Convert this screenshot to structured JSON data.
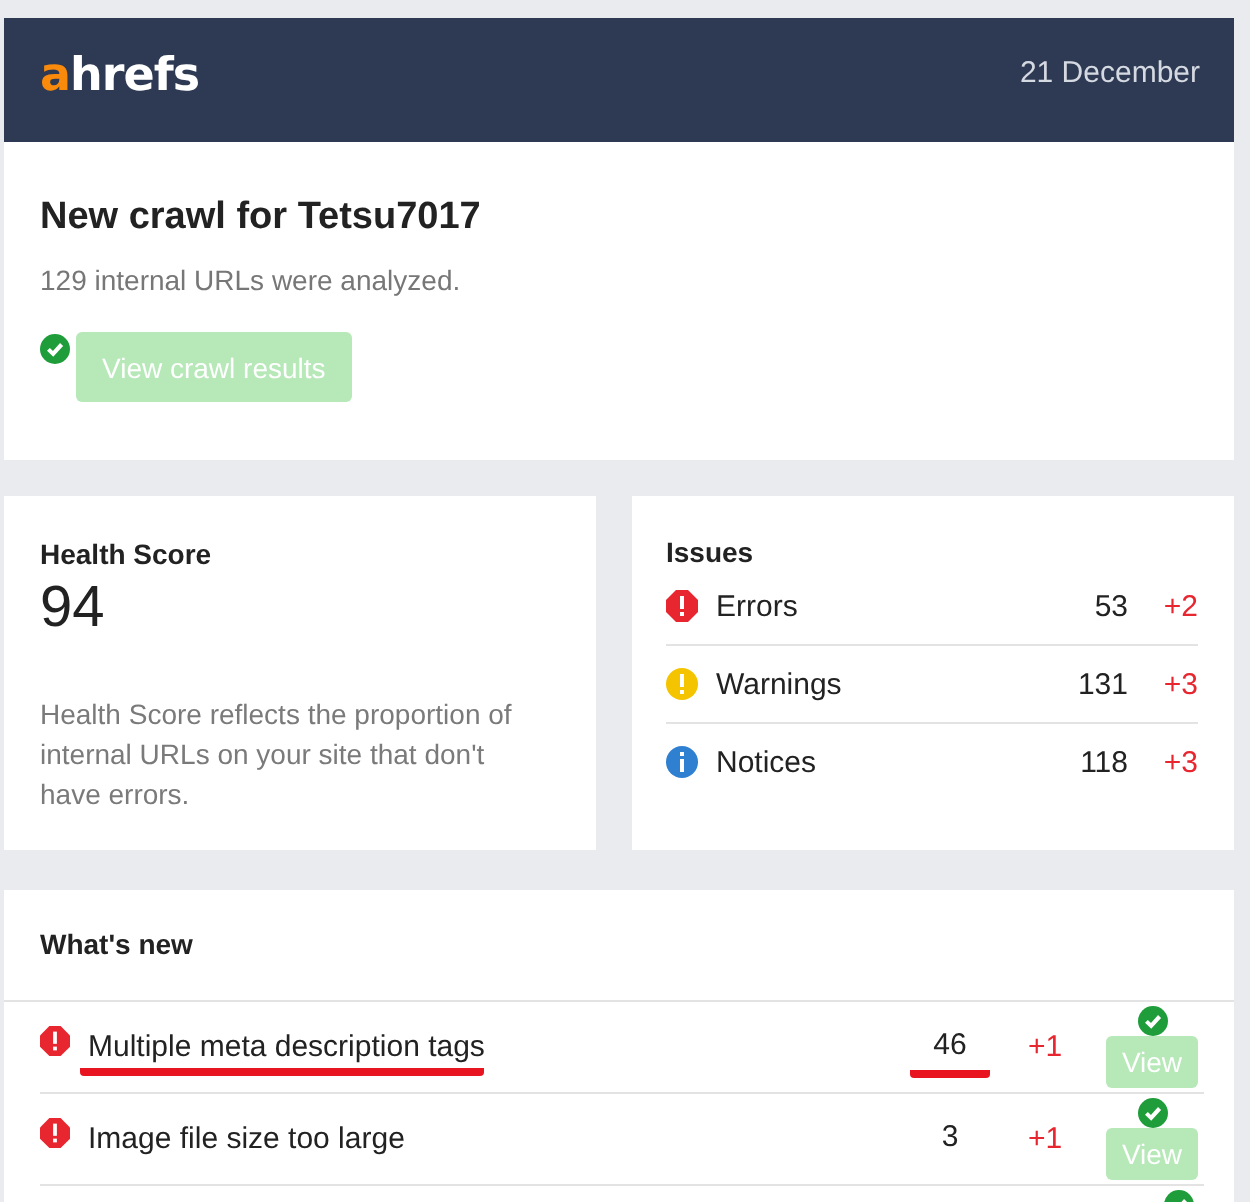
{
  "header": {
    "logo_accent": "a",
    "logo_rest": "hrefs",
    "date": "21 December"
  },
  "crawl": {
    "title": "New crawl for Tetsu7017",
    "subtitle": "129 internal URLs were analyzed.",
    "button": "View crawl results",
    "done": true
  },
  "health": {
    "title": "Health Score",
    "score": "94",
    "description": "Health Score reflects the proportion of internal URLs on your site that don't have errors."
  },
  "issues": {
    "title": "Issues",
    "rows": [
      {
        "kind": "error",
        "label": "Errors",
        "count": "53",
        "change": "+2"
      },
      {
        "kind": "warning",
        "label": "Warnings",
        "count": "131",
        "change": "+3"
      },
      {
        "kind": "notice",
        "label": "Notices",
        "count": "118",
        "change": "+3"
      }
    ]
  },
  "whats_new": {
    "title": "What's new",
    "rows": [
      {
        "kind": "error",
        "label": "Multiple meta description tags",
        "count": "46",
        "change": "+1",
        "button": "View",
        "highlighted": true,
        "done": true
      },
      {
        "kind": "error",
        "label": "Image file size too large",
        "count": "3",
        "change": "+1",
        "button": "View",
        "highlighted": false,
        "done": true
      }
    ]
  }
}
